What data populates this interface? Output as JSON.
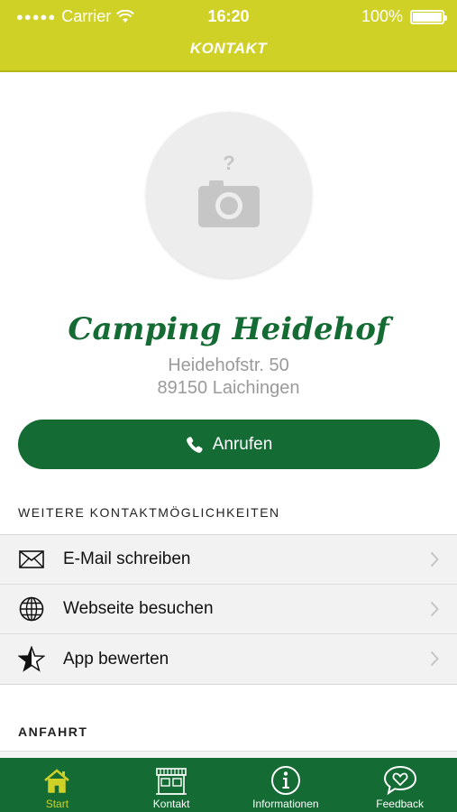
{
  "status_bar": {
    "carrier": "Carrier",
    "time": "16:20",
    "battery": "100%"
  },
  "nav": {
    "title": "KONTAKT"
  },
  "profile": {
    "name": "Camping Heidehof",
    "street": "Heidehofstr. 50",
    "city": "89150 Laichingen"
  },
  "call_button": {
    "label": "Anrufen"
  },
  "sections": {
    "more_contact": "WEITERE KONTAKTMÖGLICHKEITEN",
    "directions": "ANFAHRT"
  },
  "contact_options": [
    {
      "label": "E-Mail schreiben",
      "icon": "envelope-icon"
    },
    {
      "label": "Webseite besuchen",
      "icon": "globe-icon"
    },
    {
      "label": "App bewerten",
      "icon": "star-icon"
    }
  ],
  "tabbar": {
    "items": [
      {
        "label": "Start",
        "icon": "home-icon",
        "active": true
      },
      {
        "label": "Kontakt",
        "icon": "storefront-icon",
        "active": false
      },
      {
        "label": "Informationen",
        "icon": "info-icon",
        "active": false
      },
      {
        "label": "Feedback",
        "icon": "heart-speech-icon",
        "active": false
      }
    ]
  },
  "colors": {
    "brand_yellow": "#cfd126",
    "brand_green": "#146b34",
    "muted_text": "#9a9a9a"
  }
}
